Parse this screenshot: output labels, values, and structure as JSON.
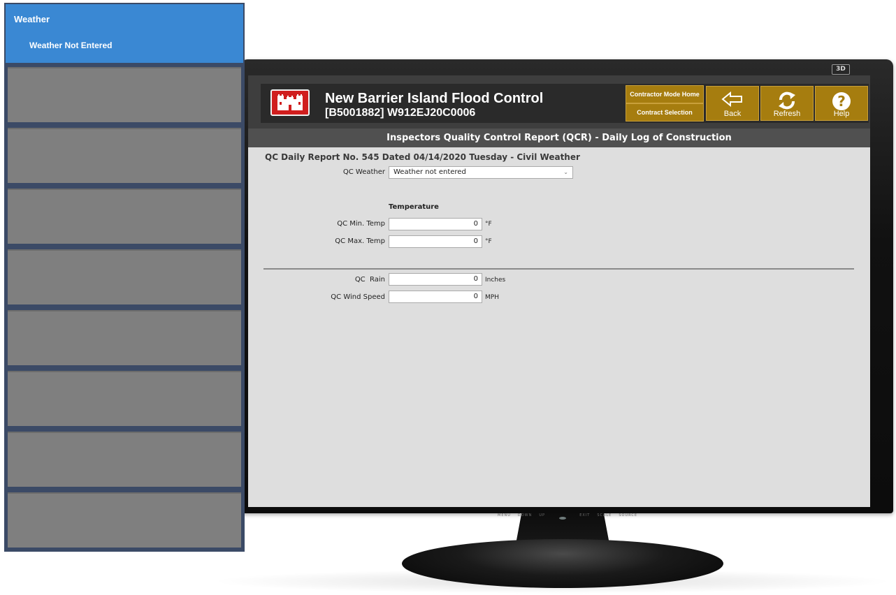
{
  "left_panel": {
    "title": "Weather",
    "status": "Weather Not Entered",
    "empty_item_count": 8
  },
  "monitor": {
    "brand_badge": "3D",
    "controls": [
      "MENU",
      "DOWN",
      "UP",
      "EXIT",
      "SCALE",
      "SOURCE"
    ]
  },
  "header": {
    "project_name": "New Barrier Island Flood Control",
    "project_code": "[B5001882] W912EJ20C0006",
    "contractor_home_label": "Contractor Mode Home",
    "contract_selection_label": "Contract Selection",
    "back_label": "Back",
    "refresh_label": "Refresh",
    "help_label": "Help"
  },
  "page": {
    "title": "Inspectors Quality Control Report (QCR) - Daily Log of Construction",
    "report_heading": "QC Daily Report No. 545 Dated 04/14/2020 Tuesday - Civil Weather"
  },
  "form": {
    "weather_label": "QC Weather",
    "weather_value": "Weather not entered",
    "temperature_heading": "Temperature",
    "min_temp_label": "QC Min. Temp",
    "min_temp_value": "0",
    "min_temp_unit": "°F",
    "max_temp_label": "QC Max. Temp",
    "max_temp_value": "0",
    "max_temp_unit": "°F",
    "rain_label": "QC  Rain",
    "rain_value": "0",
    "rain_unit": "Inches",
    "wind_label": "QC Wind Speed",
    "wind_value": "0",
    "wind_unit": "MPH"
  },
  "colors": {
    "panel_active": "#3a88d3",
    "panel_item": "#7f7f7f",
    "header_button": "#a67d0f",
    "logo_red": "#d01e1e",
    "title_bar": "#505050",
    "screen_bg": "#dedede"
  }
}
